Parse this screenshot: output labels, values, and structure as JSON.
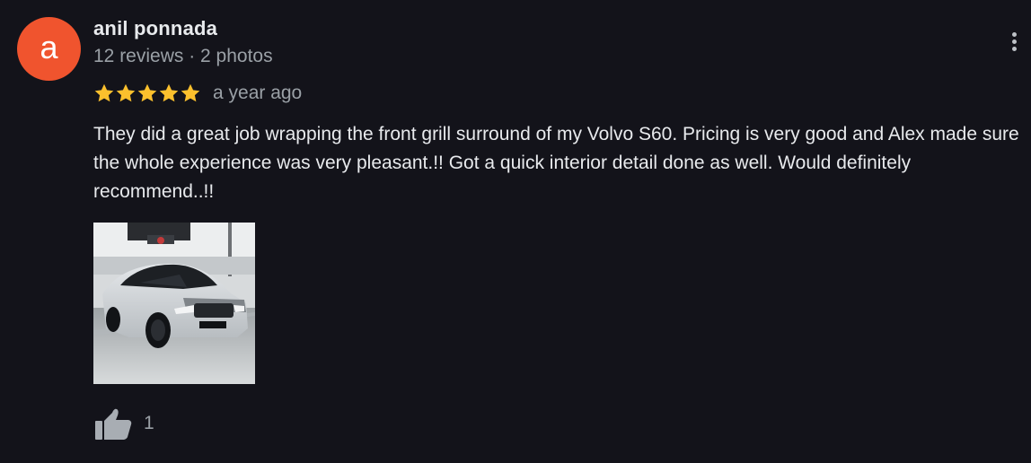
{
  "review": {
    "avatar_letter": "a",
    "avatar_color": "#f0542e",
    "author": "anil ponnada",
    "meta": "12 reviews · 2 photos",
    "rating": 5,
    "rating_max": 5,
    "star_color": "#fbc02d",
    "time": "a year ago",
    "text": "They did a great job wrapping the front grill surround of my Volvo S60. Pricing is very good and Alex made sure the whole experience was very pleasant.!! Got a quick interior detail done as well. Would definitely recommend..!!",
    "photo_icon": "car-photo",
    "like_icon": "thumbs-up-icon",
    "like_count": "1",
    "menu_icon": "more-vert-icon"
  }
}
